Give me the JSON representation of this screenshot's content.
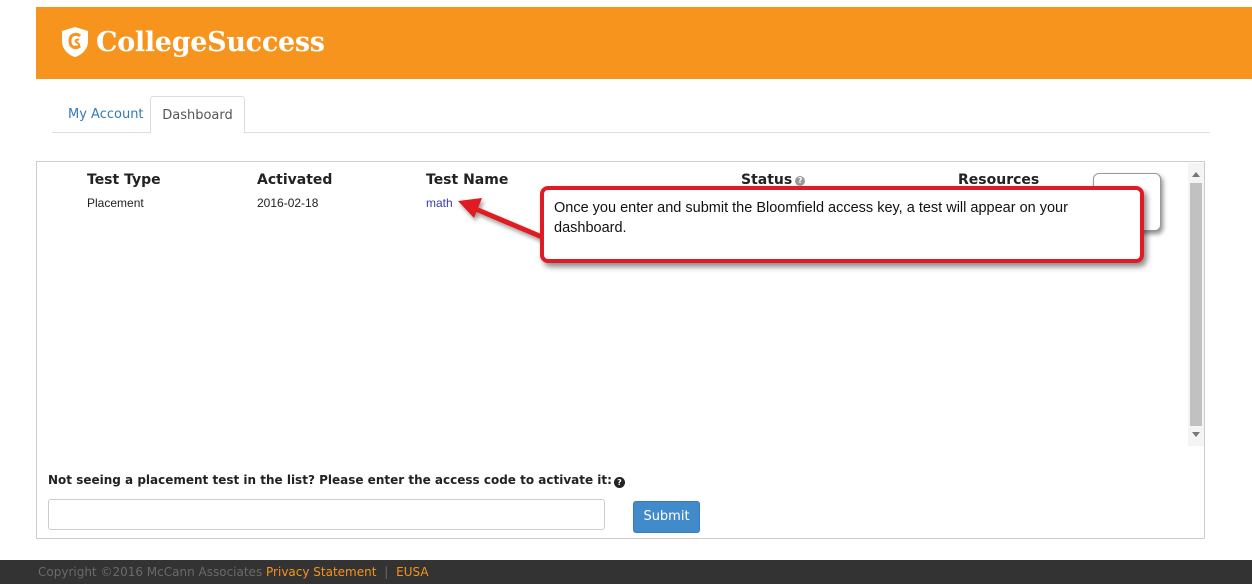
{
  "brand": {
    "name": "CollegeSuccess",
    "color": "#f7941d"
  },
  "tabs": [
    {
      "label": "My Account",
      "active": false
    },
    {
      "label": "Dashboard",
      "active": true
    }
  ],
  "table": {
    "headers": [
      "Test Type",
      "Activated",
      "Test Name",
      "Status",
      "Resources"
    ],
    "rows": [
      {
        "test_type": "Placement",
        "activated": "2016-02-18",
        "test_name": "math"
      }
    ]
  },
  "callout": {
    "text": "Once you enter and submit the Bloomfield access key, a test will appear on your dashboard.",
    "border_color": "#e01b24"
  },
  "activation": {
    "prompt": "Not seeing a placement test in the list? Please enter the access code to activate it:",
    "input_value": "",
    "submit_label": "Submit"
  },
  "footer": {
    "copyright": "Copyright ©2016 McCann Associates",
    "links": [
      "Privacy Statement",
      "EUSA"
    ],
    "separator": "|"
  }
}
